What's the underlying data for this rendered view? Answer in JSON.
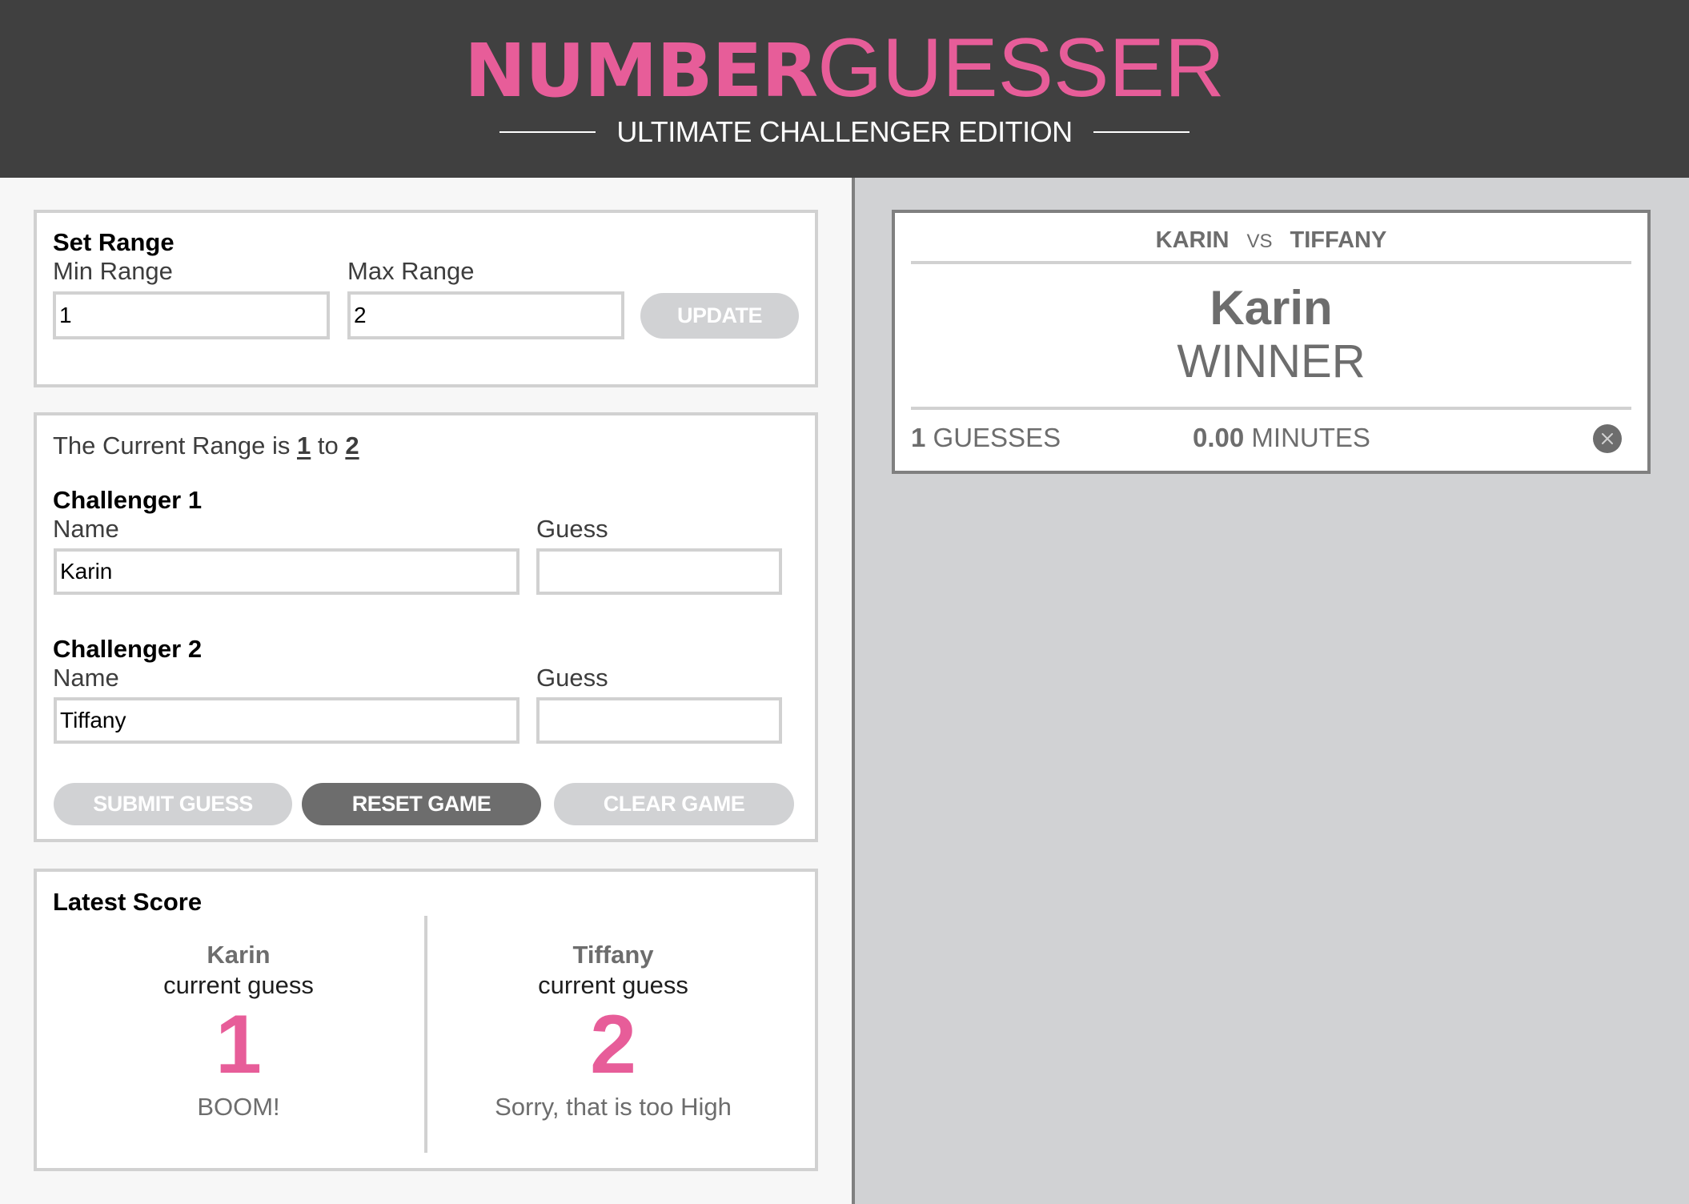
{
  "header": {
    "title_bold": "NUMBER",
    "title_light": "GUESSER",
    "subtitle": "ULTIMATE CHALLENGER EDITION"
  },
  "colors": {
    "accent": "#e75d99",
    "header_bg": "#404040",
    "button_disabled": "#d1d2d4",
    "button_active": "#6d6d6d",
    "border": "#d1d1d1",
    "card_border": "#808080"
  },
  "set_range": {
    "heading": "Set Range",
    "min_label": "Min Range",
    "min_value": "1",
    "max_label": "Max Range",
    "max_value": "2",
    "update_label": "UPDATE"
  },
  "game": {
    "range_prefix": "The Current Range is",
    "range_min": "1",
    "range_joiner": "to",
    "range_max": "2",
    "challenger1": {
      "heading": "Challenger 1",
      "name_label": "Name",
      "name_value": "Karin",
      "guess_label": "Guess",
      "guess_value": ""
    },
    "challenger2": {
      "heading": "Challenger 2",
      "name_label": "Name",
      "name_value": "Tiffany",
      "guess_label": "Guess",
      "guess_value": ""
    },
    "submit_label": "SUBMIT GUESS",
    "reset_label": "RESET GAME",
    "clear_label": "CLEAR GAME"
  },
  "latest_score": {
    "heading": "Latest Score",
    "players": [
      {
        "name": "Karin",
        "sub": "current guess",
        "guess": "1",
        "message": "BOOM!"
      },
      {
        "name": "Tiffany",
        "sub": "current guess",
        "guess": "2",
        "message": "Sorry, that is too High"
      }
    ]
  },
  "result_card": {
    "player1": "KARIN",
    "vs": "VS",
    "player2": "TIFFANY",
    "winner_name": "Karin",
    "winner_label": "WINNER",
    "guesses_count": "1",
    "guesses_label": "GUESSES",
    "minutes_value": "0.00",
    "minutes_label": "MINUTES",
    "close_icon": "close-icon"
  }
}
